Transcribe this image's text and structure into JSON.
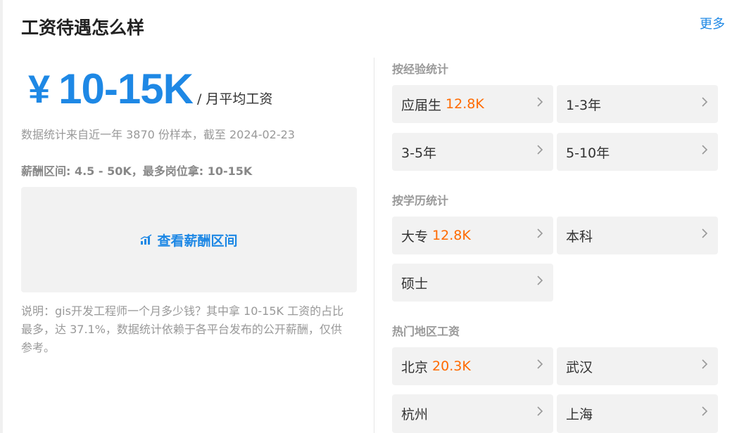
{
  "header": {
    "title": "工资待遇怎么样",
    "more_label": "更多"
  },
  "salary": {
    "currency": "¥",
    "range": "10-15K",
    "unit": "/ 月平均工资"
  },
  "stat_note": "数据统计来自近一年 3870 份样本，截至 2024-02-23",
  "range_info": "薪酬区间: 4.5 - 50K，最多岗位拿: 10-15K",
  "chart_link": {
    "label": "查看薪酬区间",
    "icon": "bar-chart-icon"
  },
  "description": "说明：gis开发工程师一个月多少钱？其中拿 10-15K 工资的占比最多，达 37.1%，数据统计依赖于各平台发布的公开薪酬，仅供参考。",
  "sections": {
    "experience": {
      "title": "按经验统计",
      "items": [
        {
          "label": "应届生",
          "value": "12.8K"
        },
        {
          "label": "1-3年",
          "value": ""
        },
        {
          "label": "3-5年",
          "value": ""
        },
        {
          "label": "5-10年",
          "value": ""
        }
      ]
    },
    "education": {
      "title": "按学历统计",
      "items": [
        {
          "label": "大专",
          "value": "12.8K"
        },
        {
          "label": "本科",
          "value": ""
        },
        {
          "label": "硕士",
          "value": ""
        }
      ]
    },
    "region": {
      "title": "热门地区工资",
      "items": [
        {
          "label": "北京",
          "value": "20.3K"
        },
        {
          "label": "武汉",
          "value": ""
        },
        {
          "label": "杭州",
          "value": ""
        },
        {
          "label": "上海",
          "value": ""
        }
      ]
    }
  },
  "colors": {
    "accent": "#1e88e5",
    "highlight": "#ff6a00",
    "card_bg": "#f2f2f2"
  }
}
